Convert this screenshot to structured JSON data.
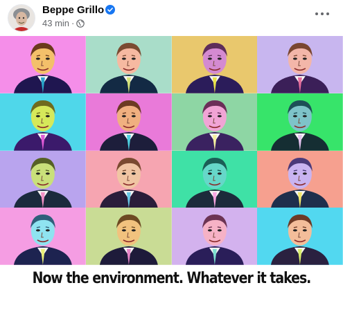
{
  "post": {
    "author": "Beppe Grillo",
    "verified": true,
    "time": "43 min",
    "separator": "·",
    "audience_icon": "globe-icon",
    "more_icon": "more-options-icon"
  },
  "image": {
    "caption": "Now the environment. Whatever it takes.",
    "grid": {
      "rows": 4,
      "cols": 4,
      "tiles": [
        {
          "bg": "#f58ee9",
          "face": "#f3c06a",
          "hair": "#6b3a1c",
          "suit": "#1f1650",
          "tie": "#2aa6c9"
        },
        {
          "bg": "#a9ddc9",
          "face": "#f6b9a1",
          "hair": "#7b4b32",
          "suit": "#132a44",
          "tie": "#d6e37a"
        },
        {
          "bg": "#e9c86d",
          "face": "#d48ad1",
          "hair": "#5e2d5a",
          "suit": "#2b1c5a",
          "tie": "#e8e24a"
        },
        {
          "bg": "#c8b6ef",
          "face": "#f3b6a9",
          "hair": "#7a4630",
          "suit": "#3b1f58",
          "tie": "#e56c9b"
        },
        {
          "bg": "#4fd7ea",
          "face": "#d6e95a",
          "hair": "#6f6b1e",
          "suit": "#3b1a6b",
          "tie": "#e05bd6"
        },
        {
          "bg": "#e97ad9",
          "face": "#f0b080",
          "hair": "#6c3b22",
          "suit": "#1d1e3b",
          "tie": "#4ed0e0"
        },
        {
          "bg": "#8ed6a4",
          "face": "#f1a4d5",
          "hair": "#6b2e58",
          "suit": "#3a2260",
          "tie": "#f4f0a0"
        },
        {
          "bg": "#37e46a",
          "face": "#7ec3c9",
          "hair": "#1d4f57",
          "suit": "#152e33",
          "tie": "#e3c2ee"
        },
        {
          "bg": "#b9a4ee",
          "face": "#c9e07a",
          "hair": "#566125",
          "suit": "#1b2a3d",
          "tie": "#f191c6"
        },
        {
          "bg": "#f6a5b1",
          "face": "#f0c5a3",
          "hair": "#7a4a30",
          "suit": "#2a1d3a",
          "tie": "#67c7e6"
        },
        {
          "bg": "#3fe1a6",
          "face": "#66d7c9",
          "hair": "#1b5d56",
          "suit": "#1c2b3b",
          "tie": "#f7a5e2"
        },
        {
          "bg": "#f6a08f",
          "face": "#c9b4f1",
          "hair": "#4b3a7a",
          "suit": "#1f2f4c",
          "tie": "#f3e76a"
        },
        {
          "bg": "#f59de3",
          "face": "#8fe3f0",
          "hair": "#2f5f7a",
          "suit": "#1d2350",
          "tie": "#eaf07a"
        },
        {
          "bg": "#c9dc95",
          "face": "#f1c27e",
          "hair": "#6d4a22",
          "suit": "#1e1b3a",
          "tie": "#e785c8"
        },
        {
          "bg": "#d3b2ee",
          "face": "#f6b2c6",
          "hair": "#6c3453",
          "suit": "#2a1e59",
          "tie": "#7ee0d1"
        },
        {
          "bg": "#52d8f0",
          "face": "#f3bd9a",
          "hair": "#6d3a26",
          "suit": "#2a2140",
          "tie": "#d7ec6a"
        }
      ]
    }
  }
}
